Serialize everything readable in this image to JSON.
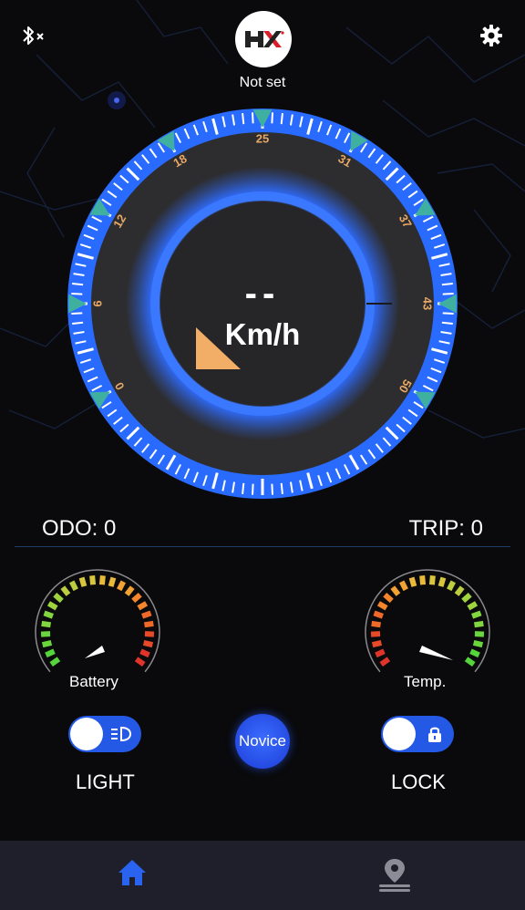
{
  "header": {
    "bluetooth_icon": "bluetooth-disabled-icon",
    "settings_icon": "gear-icon",
    "logo": "brand-logo",
    "device_name": "Not set"
  },
  "speedometer": {
    "scale_labels": [
      "0",
      "6",
      "12",
      "18",
      "25",
      "31",
      "37",
      "43",
      "50"
    ],
    "speed_value": "--",
    "unit": "Km/h"
  },
  "stats": {
    "odo_label": "ODO: 0",
    "trip_label": "TRIP: 0"
  },
  "gauges": {
    "battery_label": "Battery",
    "temp_label": "Temp."
  },
  "controls": {
    "light_label": "LIGHT",
    "lock_label": "LOCK",
    "mode_button": "Novice",
    "light_on": false,
    "lock_on": false
  },
  "tabbar": {
    "home_icon": "home-icon",
    "map_icon": "location-pin-icon",
    "active": "home"
  },
  "colors": {
    "accent": "#2459e6",
    "ring_blue": "#2f6cff",
    "marker_teal": "#3fb0a0",
    "label_orange": "#e8a865",
    "tabbar_bg": "#1e1f2a"
  }
}
